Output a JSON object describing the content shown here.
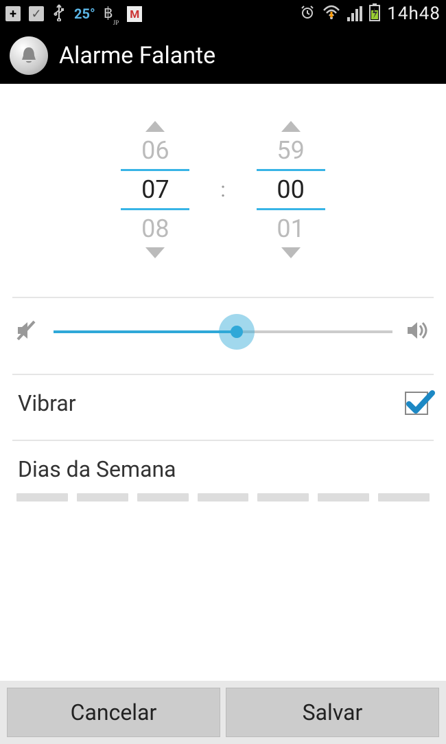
{
  "statusbar": {
    "temp": "25°",
    "currency": "฿",
    "currency_sub": "JP",
    "mail": "M",
    "time": "14h48"
  },
  "actionbar": {
    "title": "Alarme Falante"
  },
  "time": {
    "hour_prev": "06",
    "hour": "07",
    "hour_next": "08",
    "colon": ":",
    "min_prev": "59",
    "min": "00",
    "min_next": "01"
  },
  "volume": {
    "percent": 54
  },
  "vibrate": {
    "label": "Vibrar",
    "checked": true
  },
  "days": {
    "label": "Dias da Semana"
  },
  "footer": {
    "cancel": "Cancelar",
    "save": "Salvar"
  }
}
